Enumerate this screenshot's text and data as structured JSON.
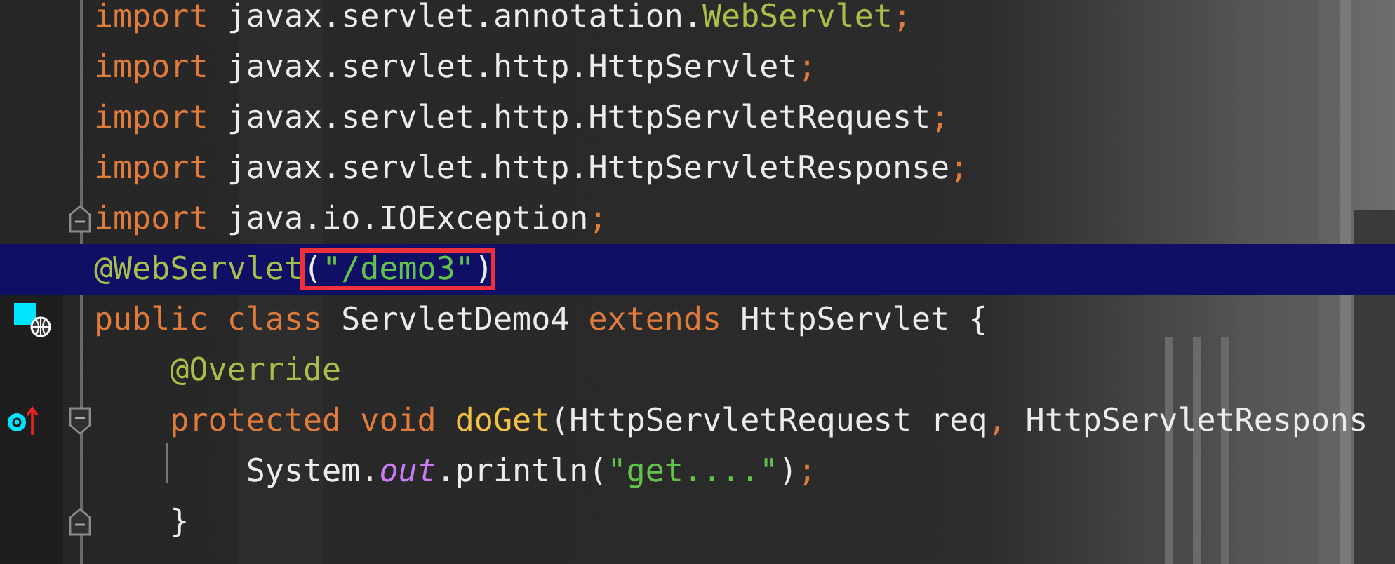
{
  "editor": {
    "lines": [
      {
        "highlighted": false,
        "tokens": [
          {
            "kind": "keyword",
            "text": "import "
          },
          {
            "kind": "plain",
            "text": "javax.servlet.annotation."
          },
          {
            "kind": "annotation",
            "text": "WebServlet"
          },
          {
            "kind": "punct",
            "text": ";"
          }
        ]
      },
      {
        "highlighted": false,
        "tokens": [
          {
            "kind": "keyword",
            "text": "import "
          },
          {
            "kind": "plain",
            "text": "javax.servlet.http.HttpServlet"
          },
          {
            "kind": "punct",
            "text": ";"
          }
        ]
      },
      {
        "highlighted": false,
        "tokens": [
          {
            "kind": "keyword",
            "text": "import "
          },
          {
            "kind": "plain",
            "text": "javax.servlet.http.HttpServletRequest"
          },
          {
            "kind": "punct",
            "text": ";"
          }
        ]
      },
      {
        "highlighted": false,
        "tokens": [
          {
            "kind": "keyword",
            "text": "import "
          },
          {
            "kind": "plain",
            "text": "javax.servlet.http.HttpServletResponse"
          },
          {
            "kind": "punct",
            "text": ";"
          }
        ]
      },
      {
        "highlighted": false,
        "fold": {
          "kind": "end"
        },
        "tokens": [
          {
            "kind": "keyword",
            "text": "import "
          },
          {
            "kind": "plain",
            "text": "java.io.IOException"
          },
          {
            "kind": "punct",
            "text": ";"
          }
        ]
      },
      {
        "highlighted": true,
        "tokens": [
          {
            "kind": "annotation",
            "text": "@WebServlet"
          },
          {
            "kind": "outlined",
            "tokens": [
              {
                "kind": "plain",
                "text": "("
              },
              {
                "kind": "string",
                "text": "\"/demo3\""
              },
              {
                "kind": "plain",
                "text": ")"
              }
            ]
          }
        ]
      },
      {
        "highlighted": false,
        "gutter_icon": {
          "kind": "class"
        },
        "tokens": [
          {
            "kind": "keyword",
            "text": "public class "
          },
          {
            "kind": "plain",
            "text": "ServletDemo4 "
          },
          {
            "kind": "keyword",
            "text": "extends "
          },
          {
            "kind": "plain",
            "text": "HttpServlet {"
          }
        ]
      },
      {
        "highlighted": false,
        "tokens": [
          {
            "kind": "annotation",
            "text": "    @Override"
          }
        ]
      },
      {
        "highlighted": false,
        "gutter_icon": {
          "kind": "override"
        },
        "fold": {
          "kind": "start"
        },
        "tokens": [
          {
            "kind": "keyword",
            "text": "    protected void "
          },
          {
            "kind": "method",
            "text": "doGet"
          },
          {
            "kind": "plain",
            "text": "(HttpServletRequest req"
          },
          {
            "kind": "punct",
            "text": ", "
          },
          {
            "kind": "plain",
            "text": "HttpServletRespons"
          }
        ]
      },
      {
        "highlighted": false,
        "guide": true,
        "tokens": [
          {
            "kind": "plain",
            "text": "        System."
          },
          {
            "kind": "static",
            "text": "out"
          },
          {
            "kind": "plain",
            "text": ".println("
          },
          {
            "kind": "string",
            "text": "\"get....\""
          },
          {
            "kind": "plain",
            "text": ")"
          },
          {
            "kind": "punct",
            "text": ";"
          }
        ]
      },
      {
        "highlighted": false,
        "fold": {
          "kind": "end"
        },
        "tokens": [
          {
            "kind": "plain",
            "text": "    }"
          }
        ]
      }
    ]
  }
}
